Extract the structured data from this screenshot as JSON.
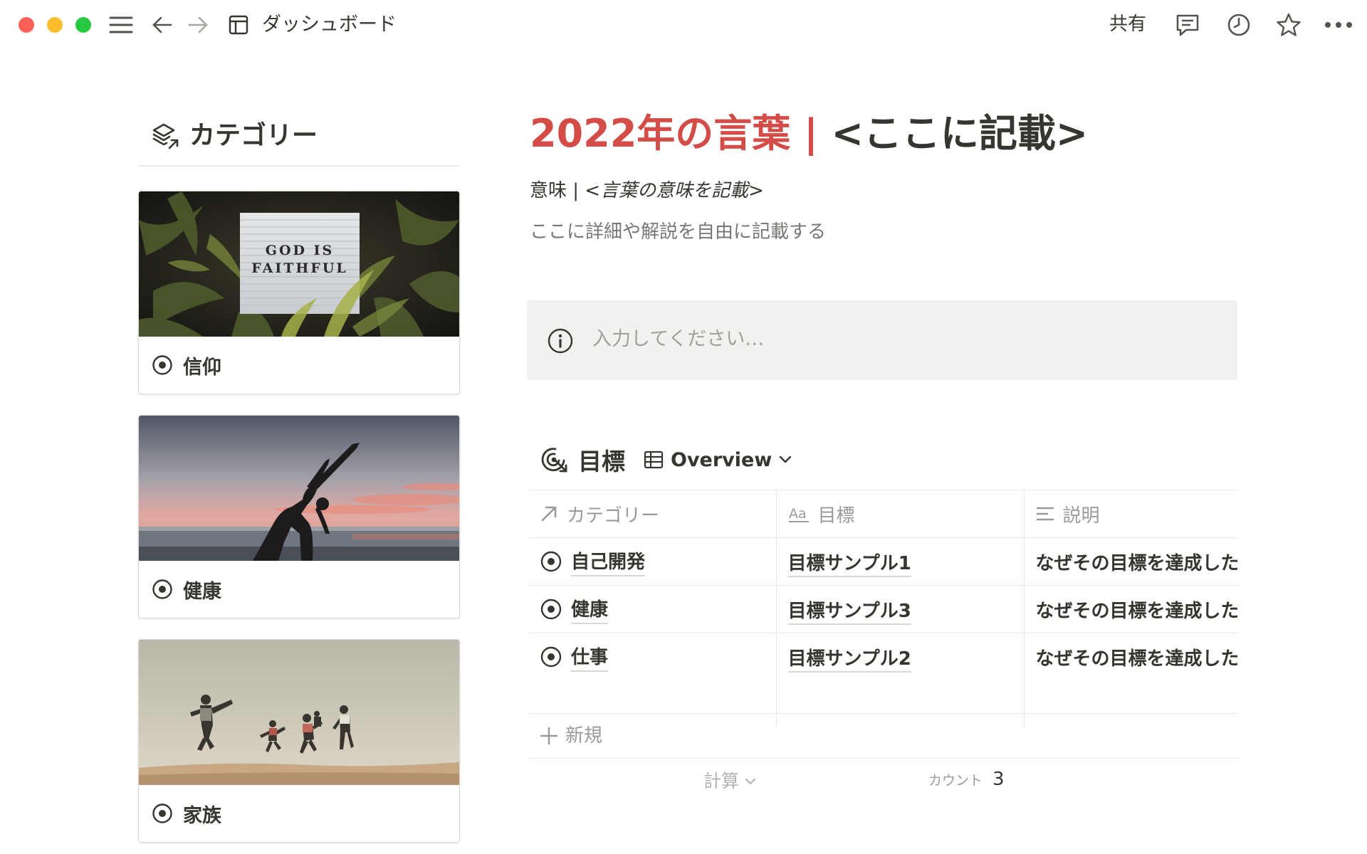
{
  "topbar": {
    "page_title": "ダッシュボード",
    "share_label": "共有",
    "icons": [
      "sidebar-menu-icon",
      "back-arrow-icon",
      "forward-arrow-icon",
      "page-layout-icon",
      "comment-icon",
      "history-icon",
      "star-icon",
      "more-icon"
    ]
  },
  "categories": {
    "title": "カテゴリー",
    "items": [
      {
        "label": "信仰",
        "cover": "letter-board-god-is-faithful",
        "cover_text_line1": "GOD IS",
        "cover_text_line2": "FAITHFUL"
      },
      {
        "label": "健康",
        "cover": "yoga-silhouette-sunset"
      },
      {
        "label": "家族",
        "cover": "family-jumping-beach"
      }
    ]
  },
  "main": {
    "title_red": "2022年の言葉 | ",
    "title_dark": "<ここに記載>",
    "meaning_prefix": "意味 | ",
    "meaning_italic": "<言葉の意味を記載>",
    "detail": "ここに詳細や解説を自由に記載する",
    "callout_placeholder": "入力してください…"
  },
  "database": {
    "name": "目標",
    "view_name": "Overview",
    "columns": [
      "カテゴリー",
      "目標",
      "説明"
    ],
    "column_type_aa": "Aa",
    "rows": [
      {
        "category": "自己開発",
        "goal": "目標サンプル1",
        "description": "なぜその目標を達成したいか"
      },
      {
        "category": "健康",
        "goal": "目標サンプル3",
        "description": "なぜその目標を達成したいか"
      },
      {
        "category": "仕事",
        "goal": "目標サンプル2",
        "description": "なぜその目標を達成したいか"
      }
    ],
    "new_label": "新規",
    "calc_label": "計算",
    "count_label": "カウント",
    "count_value": "3"
  },
  "colors": {
    "accent_red": "#d44c47",
    "text": "#37352f",
    "muted": "#9b9a97",
    "callout_bg": "#f1f1ef"
  }
}
